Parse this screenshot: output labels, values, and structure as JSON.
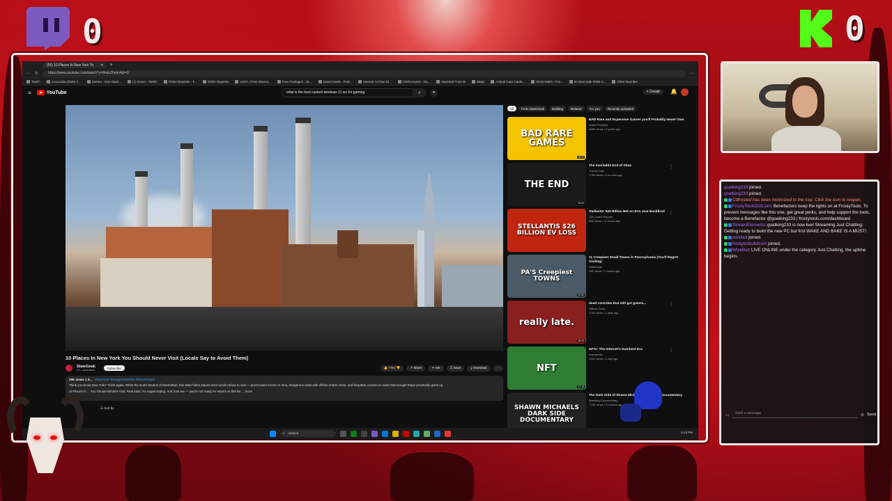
{
  "overlay": {
    "twitch_score": "0",
    "kick_score": "0",
    "colors": {
      "twitch": "#7d5bbe",
      "kick": "#53fc18",
      "accent": "#b40f17"
    }
  },
  "browser": {
    "tab_title": "(50) 10 Places In New York Yo",
    "url": "https://www.youtube.com/watch?v=8mjoZhejt-A&t=0",
    "bookmarks": [
      "Twitch",
      "Anaconda (2025) Y...",
      "Stream - Kick Dash...",
      "(1) Home - Twitch",
      "FitGirl Repacks - T...",
      "DODI Repacks",
      "1337x | Free Movies...",
      "Free Packages - 3a...",
      "Game Deals - Find...",
      "Internet Archive Gl...",
      "CDRomance - Da...",
      "Imported From IE",
      "Maps",
      "Animal Care Cards...",
      "XIGGAMES • Fre...",
      "25 Best Safe ROM S...",
      "Other favorites"
    ]
  },
  "youtube": {
    "logo": "YouTube",
    "search_query": "what is the best custom windows 11 iso for gaming",
    "create_label": "+ Create",
    "video": {
      "title": "10 Places In New York You Should Never Visit (Locals Say to Avoid Them)",
      "channel": "StateGeak",
      "subscribers": "4.4... subscribers",
      "subscribe_label": "Subscribe",
      "likes": "776",
      "share_label": "Share",
      "ask_label": "Ask",
      "save_label": "Save",
      "download_label": "Download",
      "meta": "29K views  1 d...",
      "tags": "#NewYork #DangerousCities #GhostTowns",
      "desc_line1": "Think you know New York? Think again. While the world dreams of Manhattan, this state hides places even locals refuse to visit — ghost towns frozen in time, dangerous cities with off-the-charts crime, and forgotten corners so eerie that Google Maps practically gives up.",
      "desc_line2": "10 Places In ... You Should NEVER Visit. Real stats. No sugarcoating. And trust me — you're not ready for what's on this list. ...more",
      "sort_label": "Sort by"
    },
    "chips": [
      "All",
      "From StateGeak",
      "Building",
      "Related",
      "For you",
      "Recently uploaded"
    ],
    "recommendations": [
      {
        "thumb": "BAD RARE GAMES",
        "title": "BAD Rare and Expensive Games you'll Probably Never Own",
        "channel": "Austin Eruption",
        "meta": "456K views • 3 years ago",
        "duration": "28:12",
        "bg": "#f5c400"
      },
      {
        "thumb": "THE END",
        "title": "The Inevitable End of Xbox",
        "channel": "The Act Man",
        "meta": "1.2M views • 4 months ago",
        "duration": "33:22",
        "bg": "#1a1a1a"
      },
      {
        "thumb": "STELLANTIS $26 BILLION EV LOSS",
        "title": "Stellantis' $26 Billion Bet on EVs Just Backfired",
        "channel": "Car Coach Reports",
        "meta": "50K views • 11 hours ago",
        "duration": "",
        "bg": "#c0260f"
      },
      {
        "thumb": "PA'S Creepiest TOWNS",
        "title": "11 Creepiest Small Towns in Pennsylvania (You'll Regret Visiting)",
        "channel": "StateGeak",
        "meta": "29K views • 2 weeks ago",
        "duration": "22:50",
        "bg": "#4a5a66"
      },
      {
        "thumb": "really late.",
        "title": "dead consoles that still got games...",
        "channel": "Nathan Sean",
        "meta": "1.1M views • 1 year ago",
        "duration": "46:43",
        "bg": "#8a1f1f"
      },
      {
        "thumb": "NFT",
        "title": "NFTs: The Internet's Dumbest Era",
        "channel": "mamabella",
        "meta": "114K views • 1 day ago",
        "duration": "27:16",
        "bg": "#2e7d32"
      },
      {
        "thumb": "SHAWN MICHAELS DARK SIDE DOCUMENTARY",
        "title": "The Dark Side of Shawn Michaels | Wrestling Documentary",
        "channel": "Wrestling Documentary",
        "meta": "776K views • 3 months ago",
        "duration": "",
        "bg": "#222"
      }
    ]
  },
  "taskbar": {
    "search_placeholder": "Search",
    "tray_time": "5:43 PM"
  },
  "chat": {
    "lines": [
      {
        "user": "goatking233",
        "text": " joined."
      },
      {
        "user": "goatking233",
        "text": " joined."
      },
      {
        "user": "",
        "text": "Cdfrosted has been minimized to the tray. Click the icon to reopen."
      },
      {
        "user": "FrostyToolsDotCom",
        "text": ": Benefactors keep the lights on at FrostyTools. To prevent messages like this one, get great perks, and help support the tools, become a Benefactor @goatking233 | frostytools.com/dashboard"
      },
      {
        "user": "StreamElements",
        "text": ": goatking233 is now live! Streaming Just Chatting: Getting ready to build the new PC but first WAKE AND BAKE IS A MUST!"
      },
      {
        "user": "wizebot",
        "text": " joined."
      },
      {
        "user": "frostytoolsdotcom",
        "text": " joined."
      },
      {
        "user": "WizeBot",
        "text": ": LIVE ONLINE under the category Just Chatting, the uptime begins."
      }
    ],
    "input_placeholder": "Send a message",
    "send_label": "Send"
  }
}
